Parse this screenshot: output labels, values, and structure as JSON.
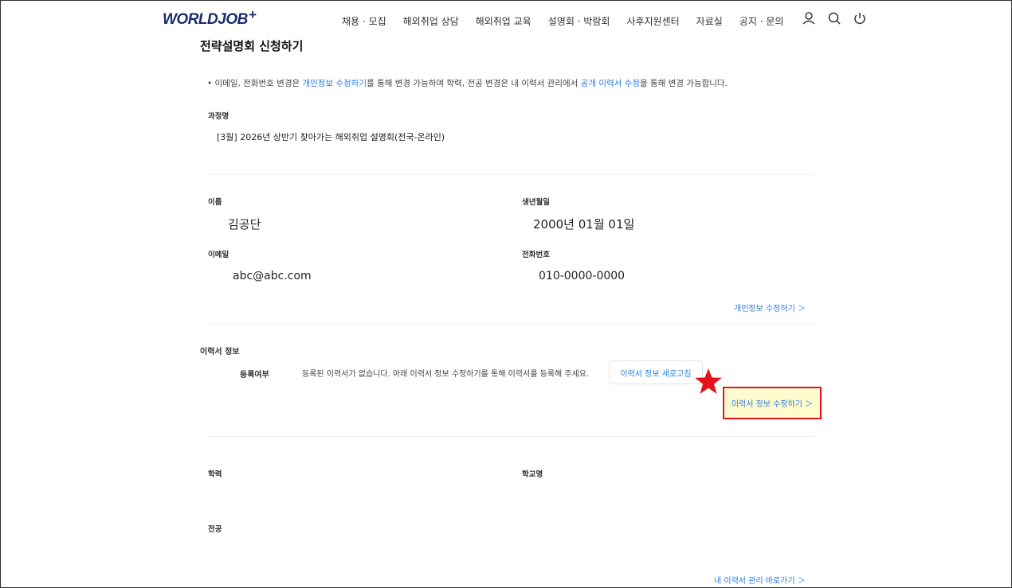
{
  "header": {
    "logo": "WORLDJOB",
    "logo_plus": "+",
    "nav": [
      "채용 · 모집",
      "해외취업 상담",
      "해외취업 교육",
      "설명회 · 박람회",
      "사후지원센터",
      "자료실",
      "공지 · 문의"
    ],
    "icons": [
      "user-icon",
      "search-icon",
      "power-icon"
    ]
  },
  "page": {
    "title": "전략설명회 신청하기",
    "notice_prefix": "•  이메일, 전화번호 변경은 ",
    "notice_link1": "개인정보 수정하기",
    "notice_mid": "를 통해 변경 가능하며 학력, 전공 변경은 내 이력서 관리에서 ",
    "notice_link2": "공개 이력서 수정",
    "notice_suffix": "을 통해 변경 가능합니다."
  },
  "course": {
    "label": "과정명",
    "value": "[3월] 2026년 상반기 찾아가는 해외취업 설명회(전국-온라인)"
  },
  "personal": {
    "name_label": "이름",
    "name": "김공단",
    "birth_label": "생년월일",
    "birth": "2000년 01월 01일",
    "email_label": "이메일",
    "email": "abc@abc.com",
    "phone_label": "전화번호",
    "phone": "010-0000-0000",
    "edit_link": "개인정보 수정하기 ＞"
  },
  "resume": {
    "section_label": "이력서 정보",
    "status_label": "등록여부",
    "status_text": "등록된 이력서가 없습니다. 아래 이력서 정보 수정하기를 통해 이력서를 등록해 주세요.",
    "refresh_button": "이력서 정보 새로고침",
    "edit_button": "이력서 정보 수정하기 ＞",
    "highlight_color": "#fffbcf",
    "highlight_border": "#e0141c",
    "star_color": "#e5141c"
  },
  "education": {
    "degree_label": "학력",
    "school_label": "학교명",
    "major_label": "전공",
    "manage_link": "내 이력서 관리 바로가기 ＞"
  }
}
